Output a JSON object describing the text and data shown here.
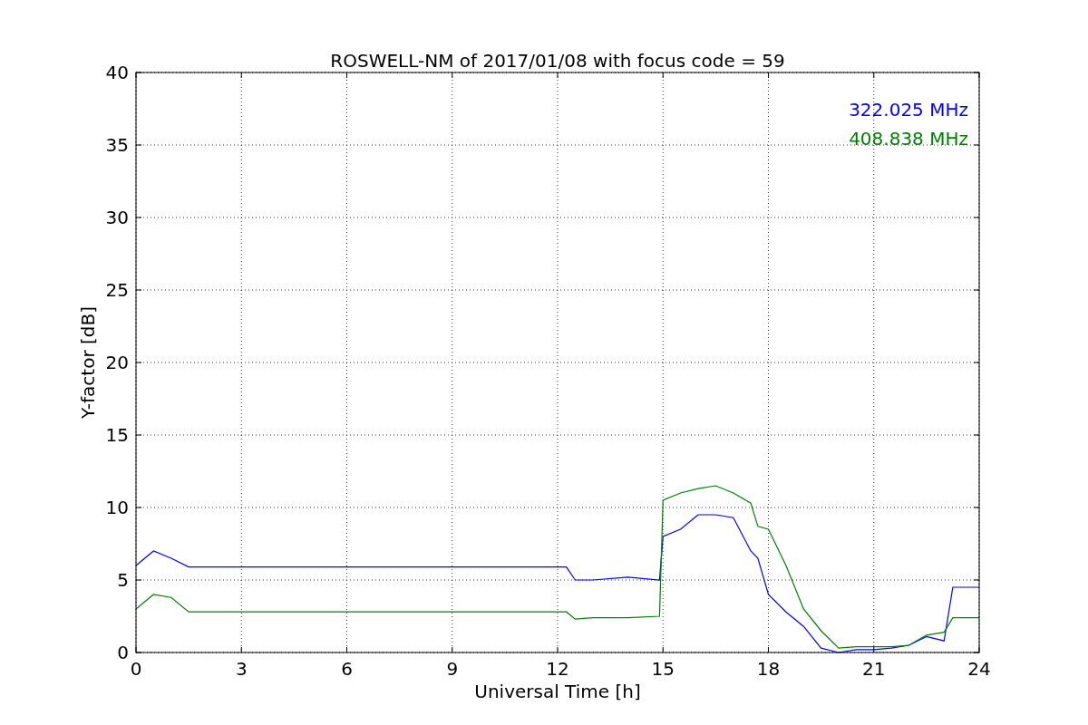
{
  "figure": {
    "chart_data": {
      "type": "line",
      "title": "ROSWELL-NM of 2017/01/08 with focus code = 59",
      "xlabel": "Universal Time [h]",
      "ylabel": "Y-factor [dB]",
      "x": [
        0,
        0.5,
        1,
        1.5,
        3,
        6,
        9,
        12.25,
        12.5,
        13,
        14,
        14.9,
        15,
        15.5,
        16,
        16.5,
        17,
        17.5,
        17.7,
        18,
        18.5,
        19,
        19.5,
        20,
        20.5,
        21,
        21.5,
        22,
        22.5,
        23,
        23.25,
        24
      ],
      "series": [
        {
          "name": "322.025 MHz",
          "color": "#0000ff",
          "values": [
            6,
            7,
            6.5,
            5.9,
            5.9,
            5.9,
            5.9,
            5.9,
            5,
            5,
            5.2,
            5,
            8,
            8.5,
            9.5,
            9.5,
            9.3,
            7,
            6.5,
            4,
            2.8,
            1.8,
            0.3,
            0,
            0.2,
            0.2,
            0.3,
            0.5,
            1.1,
            0.8,
            4.5,
            4.5
          ]
        },
        {
          "name": "408.838 MHz",
          "color": "#008000",
          "values": [
            3,
            4,
            3.8,
            2.8,
            2.8,
            2.8,
            2.8,
            2.8,
            2.3,
            2.4,
            2.4,
            2.5,
            10.5,
            11,
            11.3,
            11.5,
            11,
            10.3,
            8.7,
            8.5,
            6,
            3,
            1.5,
            0.3,
            0.4,
            0.4,
            0.4,
            0.5,
            1.2,
            1.4,
            2.4,
            2.4
          ]
        }
      ],
      "xlim": [
        0,
        24
      ],
      "ylim": [
        0,
        40
      ],
      "xticks": [
        0,
        3,
        6,
        9,
        12,
        15,
        18,
        21,
        24
      ],
      "yticks": [
        0,
        5,
        10,
        15,
        20,
        25,
        30,
        35,
        40
      ],
      "grid": true
    }
  }
}
